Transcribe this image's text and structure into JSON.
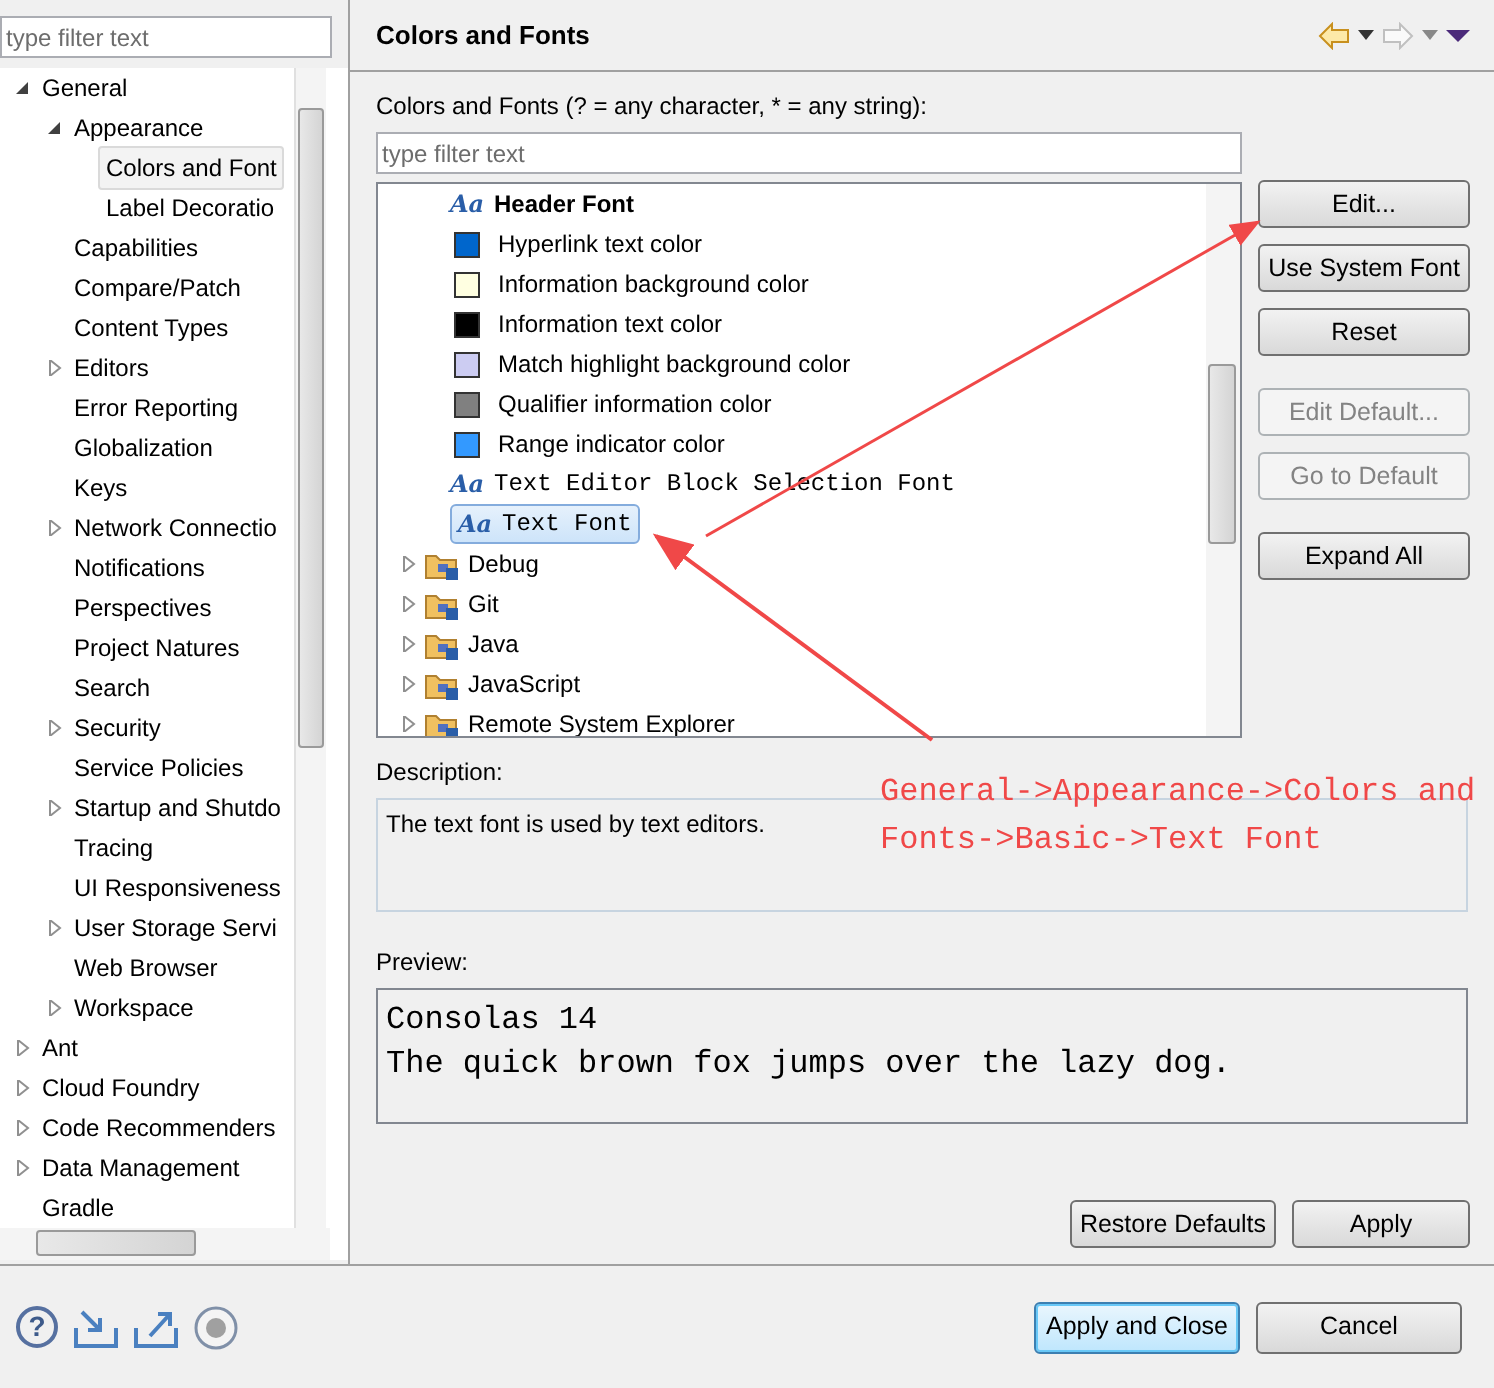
{
  "nav_filter": {
    "placeholder": "type filter text"
  },
  "nav_tree": [
    {
      "label": "General",
      "expanded": true,
      "selected": false,
      "children": [
        {
          "label": "Appearance",
          "expanded": true,
          "selected": false,
          "children": [
            {
              "label": "Colors and Font",
              "selected": true
            },
            {
              "label": "Label Decoratio",
              "selected": false
            }
          ]
        },
        {
          "label": "Capabilities",
          "selected": false
        },
        {
          "label": "Compare/Patch",
          "selected": false
        },
        {
          "label": "Content Types",
          "selected": false
        },
        {
          "label": "Editors",
          "expanded": false,
          "selected": false
        },
        {
          "label": "Error Reporting",
          "selected": false
        },
        {
          "label": "Globalization",
          "selected": false
        },
        {
          "label": "Keys",
          "selected": false
        },
        {
          "label": "Network Connectio",
          "expanded": false,
          "selected": false
        },
        {
          "label": "Notifications",
          "selected": false
        },
        {
          "label": "Perspectives",
          "selected": false
        },
        {
          "label": "Project Natures",
          "selected": false
        },
        {
          "label": "Search",
          "selected": false
        },
        {
          "label": "Security",
          "expanded": false,
          "selected": false
        },
        {
          "label": "Service Policies",
          "selected": false
        },
        {
          "label": "Startup and Shutdo",
          "expanded": false,
          "selected": false
        },
        {
          "label": "Tracing",
          "selected": false
        },
        {
          "label": "UI Responsiveness",
          "selected": false
        },
        {
          "label": "User Storage Servi",
          "expanded": false,
          "selected": false
        },
        {
          "label": "Web Browser",
          "selected": false
        },
        {
          "label": "Workspace",
          "expanded": false,
          "selected": false
        }
      ]
    },
    {
      "label": "Ant",
      "expanded": false,
      "selected": false
    },
    {
      "label": "Cloud Foundry",
      "expanded": false,
      "selected": false
    },
    {
      "label": "Code Recommenders",
      "expanded": false,
      "selected": false
    },
    {
      "label": "Data Management",
      "expanded": false,
      "selected": false
    },
    {
      "label": "Gradle",
      "selected": false
    }
  ],
  "page": {
    "title": "Colors and Fonts"
  },
  "filter_label": "Colors and Fonts (? = any character, * = any string):",
  "filter": {
    "placeholder": "type filter text"
  },
  "entries": [
    {
      "kind": "heading",
      "icon": "Aa",
      "label": "Header Font",
      "selected": false
    },
    {
      "kind": "color",
      "color": "#0066cc",
      "label": "Hyperlink text color",
      "selected": false
    },
    {
      "kind": "color",
      "color": "#ffffe1",
      "label": "Information background color",
      "selected": false
    },
    {
      "kind": "color",
      "color": "#000000",
      "label": "Information text color",
      "selected": false
    },
    {
      "kind": "color",
      "color": "#ccccf2",
      "label": "Match highlight background color",
      "selected": false
    },
    {
      "kind": "color",
      "color": "#808080",
      "label": "Qualifier information color",
      "selected": false
    },
    {
      "kind": "color",
      "color": "#3399ff",
      "label": "Range indicator color",
      "selected": false
    },
    {
      "kind": "font",
      "icon": "Aa",
      "label": "Text Editor Block Selection Font",
      "selected": false
    },
    {
      "kind": "font",
      "icon": "Aa",
      "label": "Text Font",
      "selected": true
    },
    {
      "kind": "category",
      "label": "Debug",
      "expanded": false,
      "selected": false
    },
    {
      "kind": "category",
      "label": "Git",
      "expanded": false,
      "selected": false
    },
    {
      "kind": "category",
      "label": "Java",
      "expanded": false,
      "selected": false
    },
    {
      "kind": "category",
      "label": "JavaScript",
      "expanded": false,
      "selected": false
    },
    {
      "kind": "category",
      "label": "Remote System Explorer",
      "expanded": false,
      "selected": false
    }
  ],
  "side_buttons": [
    {
      "label": "Edit...",
      "disabled": false
    },
    {
      "label": "Use System Font",
      "disabled": false
    },
    {
      "label": "Reset",
      "disabled": false
    },
    {
      "label": "Edit Default...",
      "disabled": true
    },
    {
      "label": "Go to Default",
      "disabled": true
    },
    {
      "label": "Expand All",
      "disabled": false
    }
  ],
  "description": {
    "label": "Description:",
    "text": "The text font is used by text editors."
  },
  "preview": {
    "label": "Preview:",
    "lines": [
      "Consolas 14",
      "The quick brown fox jumps over the lazy dog."
    ]
  },
  "page_buttons": [
    "Restore Defaults",
    "Apply"
  ],
  "help_icon": "?",
  "dialog_buttons": [
    {
      "label": "Apply and Close",
      "default": true
    },
    {
      "label": "Cancel",
      "default": false
    }
  ],
  "annotation": {
    "text": "General->Appearance->Colors and Fonts->Basic->Text Font"
  }
}
